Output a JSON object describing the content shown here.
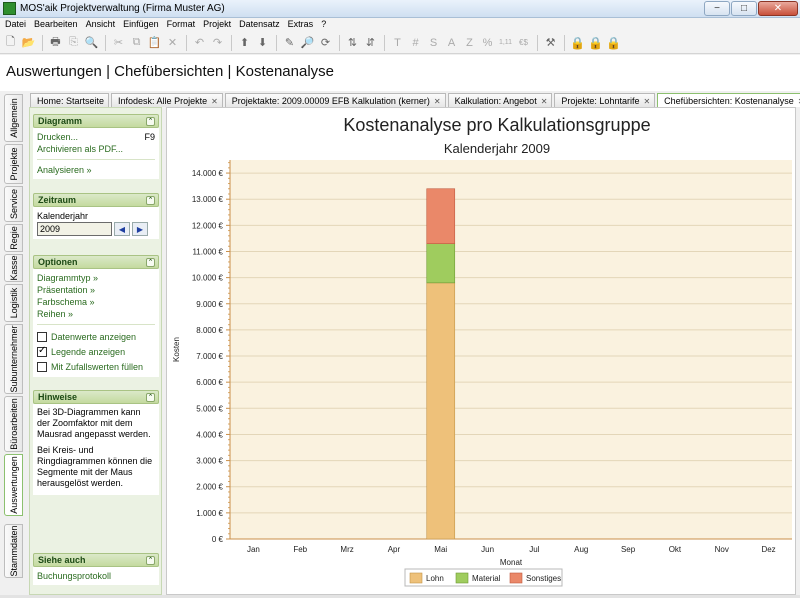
{
  "window": {
    "title": "MOS'aik Projektverwaltung (Firma Muster AG)",
    "btn_min": "−",
    "btn_max": "□",
    "btn_close": "✕"
  },
  "menu": [
    "Datei",
    "Bearbeiten",
    "Ansicht",
    "Einfügen",
    "Format",
    "Projekt",
    "Datensatz",
    "Extras",
    "?"
  ],
  "toolbar_labels": {
    "t1": "T",
    "t2": "#",
    "t3": "S",
    "t4": "A",
    "t5": "Z",
    "t6": "%",
    "t7": "1,11",
    "t8": "€$"
  },
  "page": {
    "title": "Auswertungen | Chefübersichten | Kostenanalyse"
  },
  "tabs": [
    {
      "label": "Home: Startseite",
      "closable": false
    },
    {
      "label": "Infodesk: Alle Projekte",
      "closable": true
    },
    {
      "label": "Projektakte: 2009.00009 EFB Kalkulation (kerner)",
      "closable": true
    },
    {
      "label": "Kalkulation: Angebot",
      "closable": true
    },
    {
      "label": "Projekte: Lohntarife",
      "closable": true
    },
    {
      "label": "Chefübersichten: Kostenanalyse",
      "closable": true
    }
  ],
  "vtabs": [
    "Allgemein",
    "Projekte",
    "Service",
    "Regie",
    "Kasse",
    "Logistik",
    "Subunternehmer",
    "Büroarbeiten",
    "Auswertungen",
    "Stammdaten"
  ],
  "panel": {
    "diagramm": {
      "title": "Diagramm",
      "print": "Drucken...",
      "print_key": "F9",
      "archive": "Archivieren als PDF...",
      "analyze": "Analysieren »"
    },
    "zeitraum": {
      "title": "Zeitraum",
      "label": "Kalenderjahr",
      "year": "2009"
    },
    "optionen": {
      "title": "Optionen",
      "links": [
        "Diagrammtyp »",
        "Präsentation »",
        "Farbschema »",
        "Reihen »"
      ],
      "checks": [
        {
          "label": "Datenwerte anzeigen",
          "checked": false
        },
        {
          "label": "Legende anzeigen",
          "checked": true
        },
        {
          "label": "Mit Zufallswerten füllen",
          "checked": false
        }
      ]
    },
    "hinweise": {
      "title": "Hinweise",
      "p1": "Bei 3D-Diagrammen kann der Zoomfaktor mit dem Mausrad angepasst werden.",
      "p2": "Bei Kreis- und Ringdiagrammen können die Segmente mit der Maus herausgelöst werden."
    },
    "siehe": {
      "title": "Siehe auch",
      "link": "Buchungsprotokoll"
    }
  },
  "colors": {
    "lohn": "#eec17a",
    "material": "#9fcc5e",
    "sonstiges": "#ea8869",
    "plot_bg": "#faf2df",
    "grid": "#e3d6b8"
  },
  "chart_data": {
    "type": "bar",
    "stacked": true,
    "title": "Kostenanalyse pro Kalkulationsgruppe",
    "subtitle": "Kalenderjahr 2009",
    "xlabel": "Monat",
    "ylabel": "Kosten",
    "categories": [
      "Jan",
      "Feb",
      "Mrz",
      "Apr",
      "Mai",
      "Jun",
      "Jul",
      "Aug",
      "Sep",
      "Okt",
      "Nov",
      "Dez"
    ],
    "series": [
      {
        "name": "Lohn",
        "values": [
          0,
          0,
          0,
          0,
          9800,
          0,
          0,
          0,
          0,
          0,
          0,
          0
        ]
      },
      {
        "name": "Material",
        "values": [
          0,
          0,
          0,
          0,
          1500,
          0,
          0,
          0,
          0,
          0,
          0,
          0
        ]
      },
      {
        "name": "Sonstiges",
        "values": [
          0,
          0,
          0,
          0,
          2100,
          0,
          0,
          0,
          0,
          0,
          0,
          0
        ]
      }
    ],
    "ylim": [
      0,
      14500
    ],
    "yticks": [
      0,
      1000,
      2000,
      3000,
      4000,
      5000,
      6000,
      7000,
      8000,
      9000,
      10000,
      11000,
      12000,
      13000,
      14000
    ],
    "ytick_labels": [
      "0 €",
      "1.000 €",
      "2.000 €",
      "3.000 €",
      "4.000 €",
      "5.000 €",
      "6.000 €",
      "7.000 €",
      "8.000 €",
      "9.000 €",
      "10.000 €",
      "11.000 €",
      "12.000 €",
      "13.000 €",
      "14.000 €"
    ],
    "grid": true,
    "legend": "bottom-center"
  }
}
